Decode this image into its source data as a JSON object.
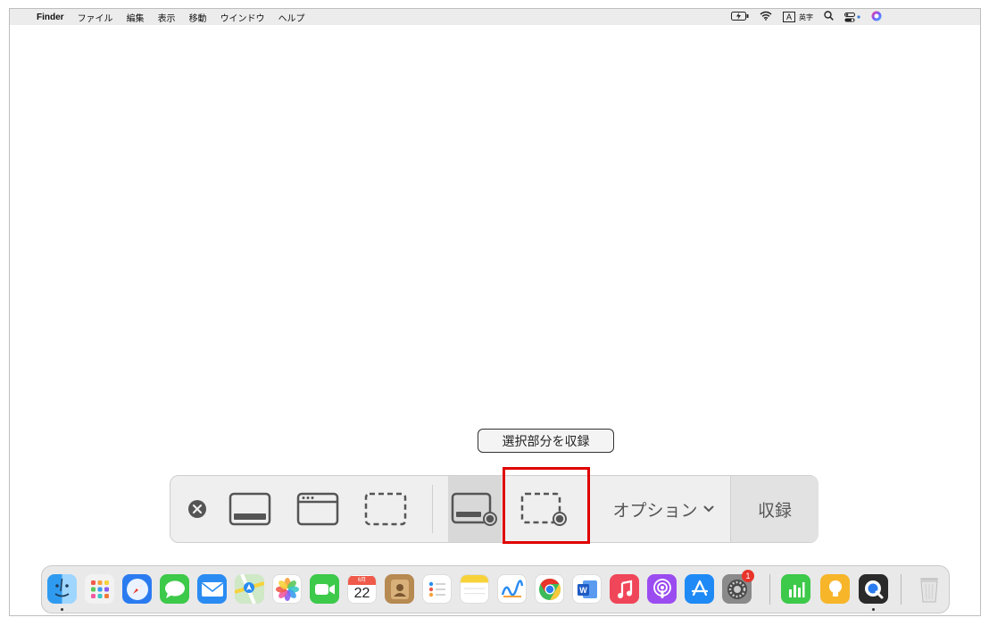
{
  "menubar": {
    "apple": "",
    "app_name": "Finder",
    "items": [
      "ファイル",
      "編集",
      "表示",
      "移動",
      "ウインドウ",
      "ヘルプ"
    ],
    "input_badge": "A",
    "input_mode": "英字"
  },
  "tooltip": {
    "text": "選択部分を収録"
  },
  "toolbar": {
    "options_label": "オプション",
    "record_label": "収録"
  },
  "dock": {
    "calendar_month": "6月",
    "calendar_day": "22",
    "settings_badge": "1"
  }
}
